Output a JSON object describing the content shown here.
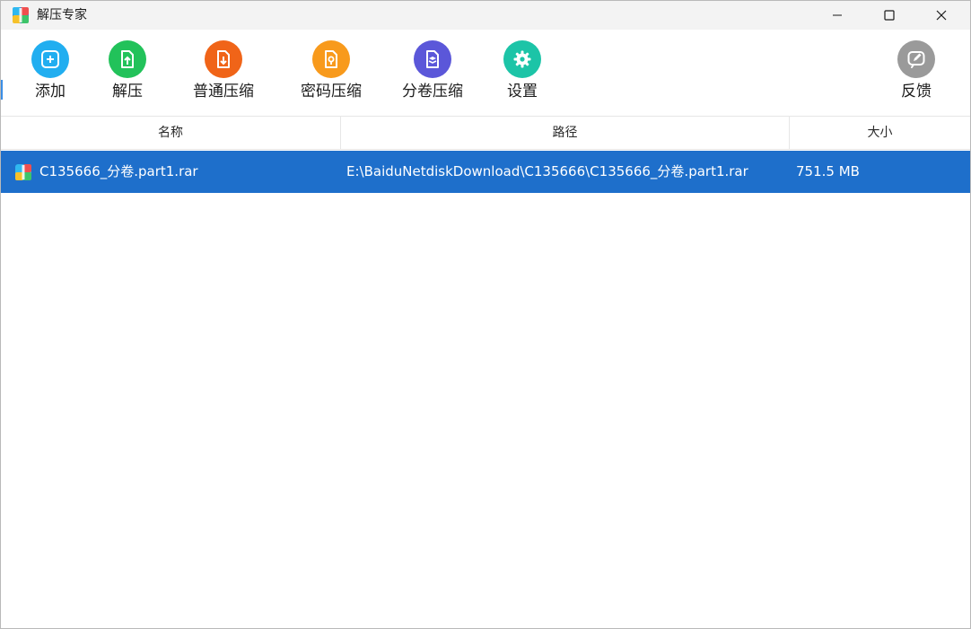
{
  "window": {
    "title": "解压专家"
  },
  "titlebar_icons": {
    "app_icon": "archive-app-icon",
    "minimize": "minimize-icon",
    "maximize": "maximize-icon",
    "close": "close-icon"
  },
  "toolbar": {
    "items": [
      {
        "label": "添加",
        "icon": "plus-icon",
        "color": "#21aef0"
      },
      {
        "label": "解压",
        "icon": "extract-file-icon",
        "color": "#22c25a"
      },
      {
        "label": "普通压缩",
        "icon": "compress-file-icon",
        "color": "#f06418"
      },
      {
        "label": "密码压缩",
        "icon": "password-file-icon",
        "color": "#f89a1c"
      },
      {
        "label": "分卷压缩",
        "icon": "split-file-icon",
        "color": "#5b57d9"
      },
      {
        "label": "设置",
        "icon": "gear-icon",
        "color": "#1cc4a7"
      }
    ],
    "feedback": {
      "label": "反馈",
      "icon": "edit-feedback-icon",
      "color": "#9a9a9a"
    }
  },
  "table": {
    "headers": [
      "名称",
      "路径",
      "大小"
    ],
    "rows": [
      {
        "name": "C135666_分卷.part1.rar",
        "path": "E:\\BaiduNetdiskDownload\\C135666\\C135666_分卷.part1.rar",
        "size": "751.5 MB",
        "icon": "rar-file-icon",
        "selected": true
      }
    ]
  },
  "colors": {
    "selection": "#1e6fcb",
    "titlebar_bg": "#f3f3f3"
  }
}
